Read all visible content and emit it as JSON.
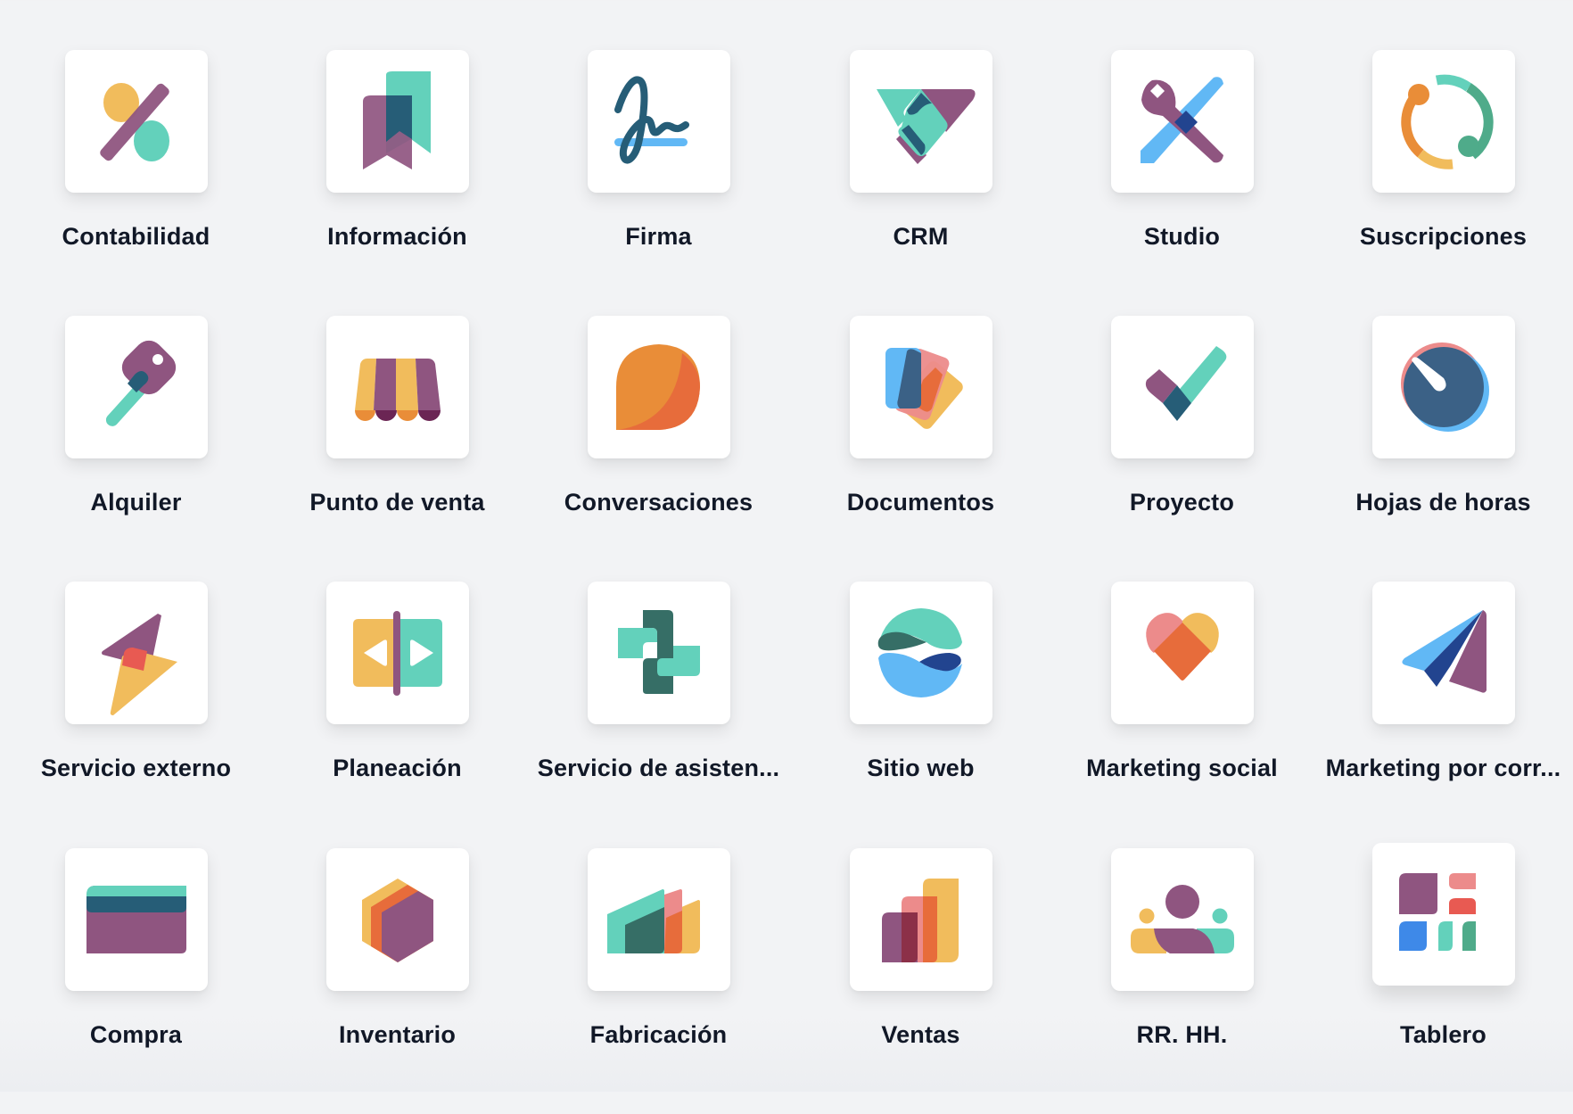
{
  "apps": [
    {
      "label": "Contabilidad",
      "icon": "accounting-icon"
    },
    {
      "label": "Información",
      "icon": "knowledge-icon"
    },
    {
      "label": "Firma",
      "icon": "sign-icon"
    },
    {
      "label": "CRM",
      "icon": "crm-icon"
    },
    {
      "label": "Studio",
      "icon": "studio-icon"
    },
    {
      "label": "Suscripciones",
      "icon": "subscriptions-icon"
    },
    {
      "label": "Alquiler",
      "icon": "rental-icon"
    },
    {
      "label": "Punto de venta",
      "icon": "point-of-sale-icon"
    },
    {
      "label": "Conversaciones",
      "icon": "discuss-icon"
    },
    {
      "label": "Documentos",
      "icon": "documents-icon"
    },
    {
      "label": "Proyecto",
      "icon": "project-icon"
    },
    {
      "label": "Hojas de horas",
      "icon": "timesheets-icon"
    },
    {
      "label": "Servicio externo",
      "icon": "field-service-icon"
    },
    {
      "label": "Planeación",
      "icon": "planning-icon"
    },
    {
      "label": "Servicio de asisten...",
      "icon": "helpdesk-icon"
    },
    {
      "label": "Sitio web",
      "icon": "website-icon"
    },
    {
      "label": "Marketing social",
      "icon": "social-marketing-icon"
    },
    {
      "label": "Marketing por corr...",
      "icon": "email-marketing-icon"
    },
    {
      "label": "Compra",
      "icon": "purchase-icon"
    },
    {
      "label": "Inventario",
      "icon": "inventory-icon"
    },
    {
      "label": "Fabricación",
      "icon": "manufacturing-icon"
    },
    {
      "label": "Ventas",
      "icon": "sales-icon"
    },
    {
      "label": "RR. HH.",
      "icon": "employees-icon"
    },
    {
      "label": "Tablero",
      "icon": "dashboards-icon"
    }
  ],
  "colors": {
    "background": "#f2f3f5",
    "tile": "#ffffff",
    "label": "#111827",
    "purple": "#8f5580",
    "teal": "#63d1bb",
    "yellow": "#f1bc5c",
    "orange": "#e98d38",
    "red_orange": "#e76c3b",
    "dark_teal": "#265d77",
    "blue": "#61b8f5",
    "navy": "#22448f",
    "pink": "#ec8b8b"
  }
}
